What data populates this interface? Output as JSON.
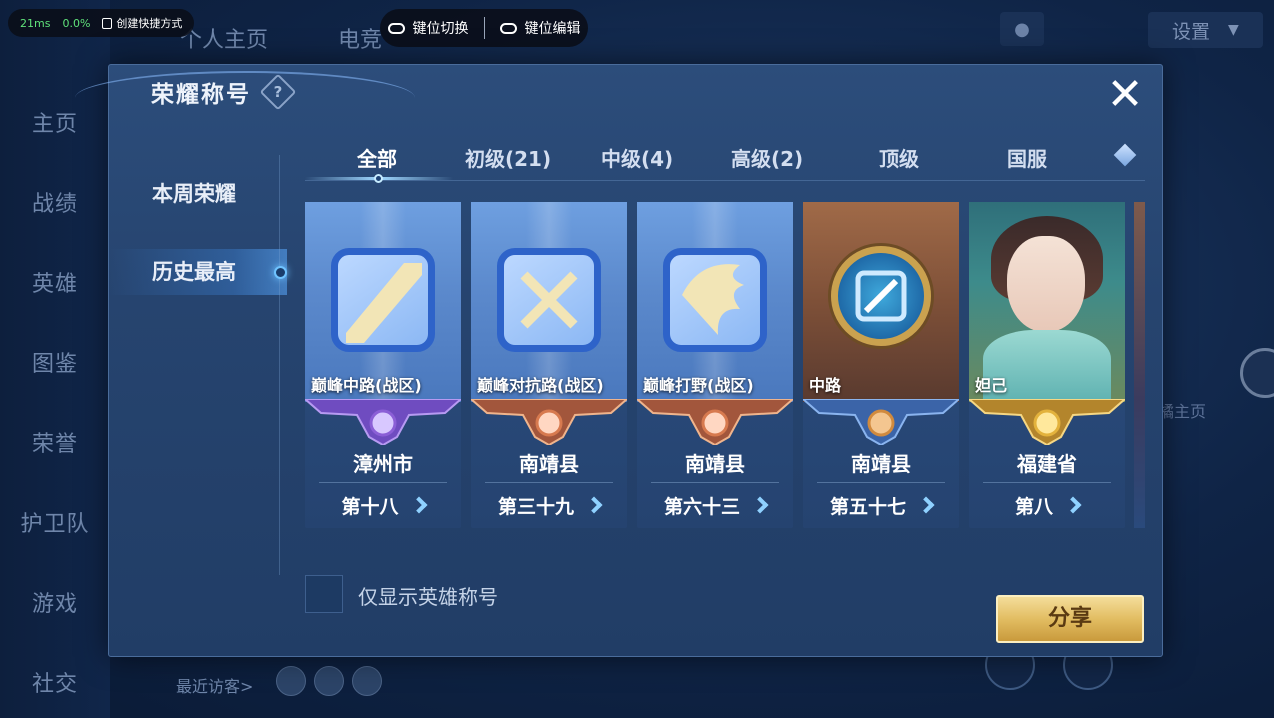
{
  "overlay": {
    "ping": "21ms",
    "loss": "0.0%",
    "shortcut_label": "创建快捷方式",
    "key_switch": "键位切换",
    "key_edit": "键位编辑"
  },
  "background": {
    "top_tabs": [
      "个人主页",
      "电竞"
    ],
    "settings_label": "设置",
    "nav": [
      "主页",
      "战绩",
      "英雄",
      "图鉴",
      "荣誉",
      "护卫队",
      "游戏",
      "社交"
    ],
    "recent_visitors": "最近访客>",
    "right_side_text": "橘主页"
  },
  "dialog": {
    "title": "荣耀称号",
    "help_symbol": "?",
    "close_symbol": "✕",
    "side_menu": [
      {
        "label": "本周荣耀",
        "active": false
      },
      {
        "label": "历史最高",
        "active": true
      }
    ],
    "tabs": [
      {
        "label": "全部",
        "active": true
      },
      {
        "label": "初级(21)",
        "active": false
      },
      {
        "label": "中级(4)",
        "active": false
      },
      {
        "label": "高级(2)",
        "active": false
      },
      {
        "label": "顶级",
        "active": false
      },
      {
        "label": "国服",
        "active": false
      }
    ],
    "cards": [
      {
        "name": "巅峰中路(战区)",
        "region": "漳州市",
        "rank": "第十八",
        "banner_color": "#8b5fd6",
        "style": "blue"
      },
      {
        "name": "巅峰对抗路(战区)",
        "region": "南靖县",
        "rank": "第三十九",
        "banner_color": "#d77a4f",
        "style": "blue"
      },
      {
        "name": "巅峰打野(战区)",
        "region": "南靖县",
        "rank": "第六十三",
        "banner_color": "#d77a4f",
        "style": "blue"
      },
      {
        "name": "中路",
        "region": "南靖县",
        "rank": "第五十七",
        "banner_color": "#d18a3e",
        "style": "brown"
      },
      {
        "name": "妲己",
        "region": "福建省",
        "rank": "第八",
        "banner_color": "#e3b23c",
        "style": "portrait"
      }
    ],
    "checkbox_label": "仅显示英雄称号",
    "share_label": "分享"
  }
}
